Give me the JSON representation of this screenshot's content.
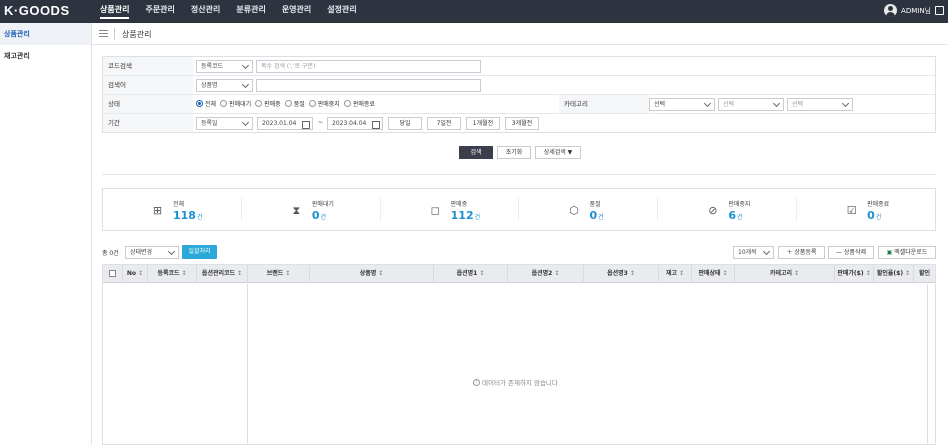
{
  "app": {
    "logo": "K·GOODS"
  },
  "nav": [
    "상품관리",
    "주문관리",
    "정산관리",
    "분류관리",
    "운영관리",
    "설정관리"
  ],
  "user": {
    "name": "ADMIN님"
  },
  "sidebar": [
    "상품관리",
    "재고관리"
  ],
  "page": {
    "title": "상품관리"
  },
  "form": {
    "code_label": "코드검색",
    "code_select": "등록코드",
    "code_placeholder": "복수 검색 (','로 구분)",
    "keyword_label": "검색어",
    "keyword_select": "상품명",
    "status_label": "상태",
    "status_options": [
      "전체",
      "판매대기",
      "판매중",
      "품절",
      "판매중지",
      "판매종료"
    ],
    "status_selected": "전체",
    "category_label": "카테고리",
    "category_selects": [
      "선택",
      "선택",
      "선택"
    ],
    "period_label": "기간",
    "period_select": "등록일",
    "date_from": "2023.01.04",
    "date_tilde": "~",
    "date_to": "2023.04.04",
    "period_buttons": [
      "당일",
      "7일전",
      "1개월전",
      "3개월전"
    ]
  },
  "search_buttons": {
    "search": "검색",
    "reset": "초기화",
    "detail": "상세검색 ▼"
  },
  "stats": [
    {
      "name": "전체",
      "value": "118",
      "unit": "건",
      "icon": "grid-icon"
    },
    {
      "name": "판매대기",
      "value": "0",
      "unit": "건",
      "icon": "hourglass-icon"
    },
    {
      "name": "판매중",
      "value": "112",
      "unit": "건",
      "icon": "bag-icon"
    },
    {
      "name": "품절",
      "value": "0",
      "unit": "건",
      "icon": "box-icon"
    },
    {
      "name": "판매중지",
      "value": "6",
      "unit": "건",
      "icon": "ban-icon"
    },
    {
      "name": "판매종료",
      "value": "0",
      "unit": "건",
      "icon": "calendar-check-icon"
    }
  ],
  "toolbar": {
    "count": "총 0건",
    "status_change": "상태변경",
    "bulk": "일괄처리",
    "page_size": "10개씩",
    "add": "상품등록",
    "delete": "상품삭제",
    "excel": "엑셀다운로드"
  },
  "table": {
    "columns": [
      "No",
      "등록코드",
      "옵션관리코드",
      "브랜드",
      "상품명",
      "옵션명1",
      "옵션명2",
      "옵션명3",
      "재고",
      "판매상태",
      "카테고리",
      "판매가($)",
      "할인율($)",
      "할인"
    ],
    "sort_symbol": "↕",
    "empty": "데이터가 존재하지 않습니다"
  },
  "colors": {
    "topbar": "#2e3340",
    "accent": "#2aa8d8",
    "stat_value": "#1d8fd0"
  }
}
